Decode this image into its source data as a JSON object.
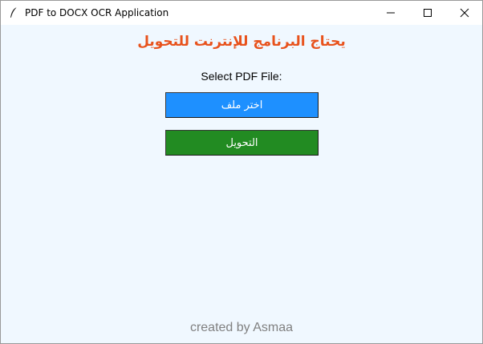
{
  "window": {
    "title": "PDF to DOCX OCR Application",
    "app_icon": "feather-icon",
    "controls": [
      "minimize-icon",
      "maximize-icon",
      "close-icon"
    ]
  },
  "main": {
    "heading": "يحتاج البرنامج للإنترنت للتحويل",
    "select_label": "Select PDF File:",
    "choose_button_label": "اختر ملف",
    "convert_button_label": "التحويل",
    "footer": "created by Asmaa"
  },
  "colors": {
    "background": "#f0f8ff",
    "heading": "#e8521c",
    "choose_button": "#1e90ff",
    "convert_button": "#228b22",
    "footer": "#808080"
  }
}
